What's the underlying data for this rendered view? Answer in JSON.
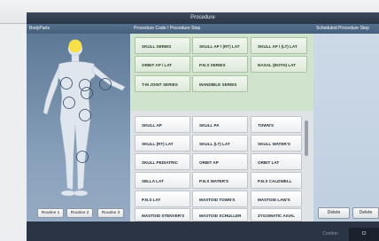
{
  "window": {
    "title": "Procedure"
  },
  "headers": {
    "body_parts": "BodyParts",
    "procedure": "Procedure Code / Procedure Step",
    "scheduled": "Scheduled Procedure Step"
  },
  "routines": [
    "Routine 1",
    "Routine 2",
    "Routine 3"
  ],
  "top_procedures": [
    "SKULL SERIES",
    "SKULL AP / (RT) LAT",
    "SKULL AP / (LT) LAT",
    "ORBIT AP / LAT",
    "P.N.S SERIES",
    "NASAL (BOTH) LAT",
    "T-M JOINT SERIES",
    "MANDIBLE SERIES"
  ],
  "bottom_procedures": [
    "SKULL AP",
    "SKULL PA",
    "TOWN'S",
    "SKULL (RT) LAT",
    "SKULL (LT) LAT",
    "SKULL WATER'S",
    "SKULL PEDIATRIC",
    "ORBIT AP",
    "ORBIT LAT",
    "SELLA LAT",
    "P.N.S WATER'S",
    "P.N.S CALDWELL",
    "P.N.S LAT",
    "MASTOID TOWN'S",
    "MASTOID LAW'S",
    "MASTOID STENVER'S",
    "MASTOID SCHULLER",
    "ZYGOMATIC AXIAL"
  ],
  "scheduled_buttons": [
    "Delete",
    "Delete"
  ],
  "footer": {
    "confirm": "Confirm",
    "close": "Cl"
  },
  "colors": {
    "header": "#46607d",
    "selected_body_part": "#f5e04a",
    "procedure_group": "#cfe3cd"
  }
}
